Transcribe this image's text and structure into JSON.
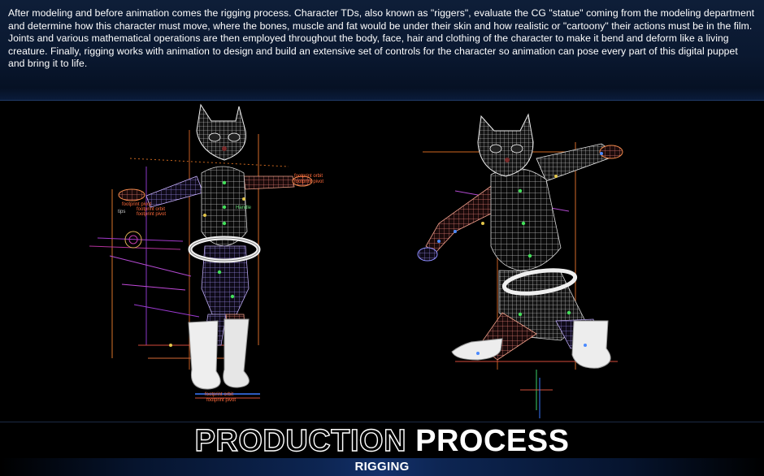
{
  "intro": {
    "text": "After modeling and before animation comes the rigging process. Character TDs, also known as \"riggers\", evaluate the CG \"statue\" coming from the modeling department and determine how this character must move, where the bones, muscle and fat would be under their skin and how realistic or \"cartoony\" their actions must be in the film. Joints and various mathematical operations are then employed throughout the body, face, hair and clothing of the character to make it bend and deform like a living creature. Finally, rigging works with animation to design and build an extensive set of controls for the character so animation can pose every part of this digital puppet and bring it to life."
  },
  "viewport": {
    "labels_left": [
      "footprint pivot",
      "footprint orbit",
      "footprint pivot",
      "tips",
      "Handle"
    ],
    "labels_feet": [
      "footprint orbit",
      "footprint pivot"
    ],
    "labels_right": [
      "footprint orbit",
      "footprint pivot"
    ]
  },
  "banner": {
    "title_outline": "PRODUCTION",
    "title_solid": "PROCESS",
    "subtitle": "RIGGING"
  },
  "colors": {
    "background": "#000000",
    "header_gradient": "#0a1830",
    "accent_blue": "#12306a",
    "text": "#ffffff"
  }
}
